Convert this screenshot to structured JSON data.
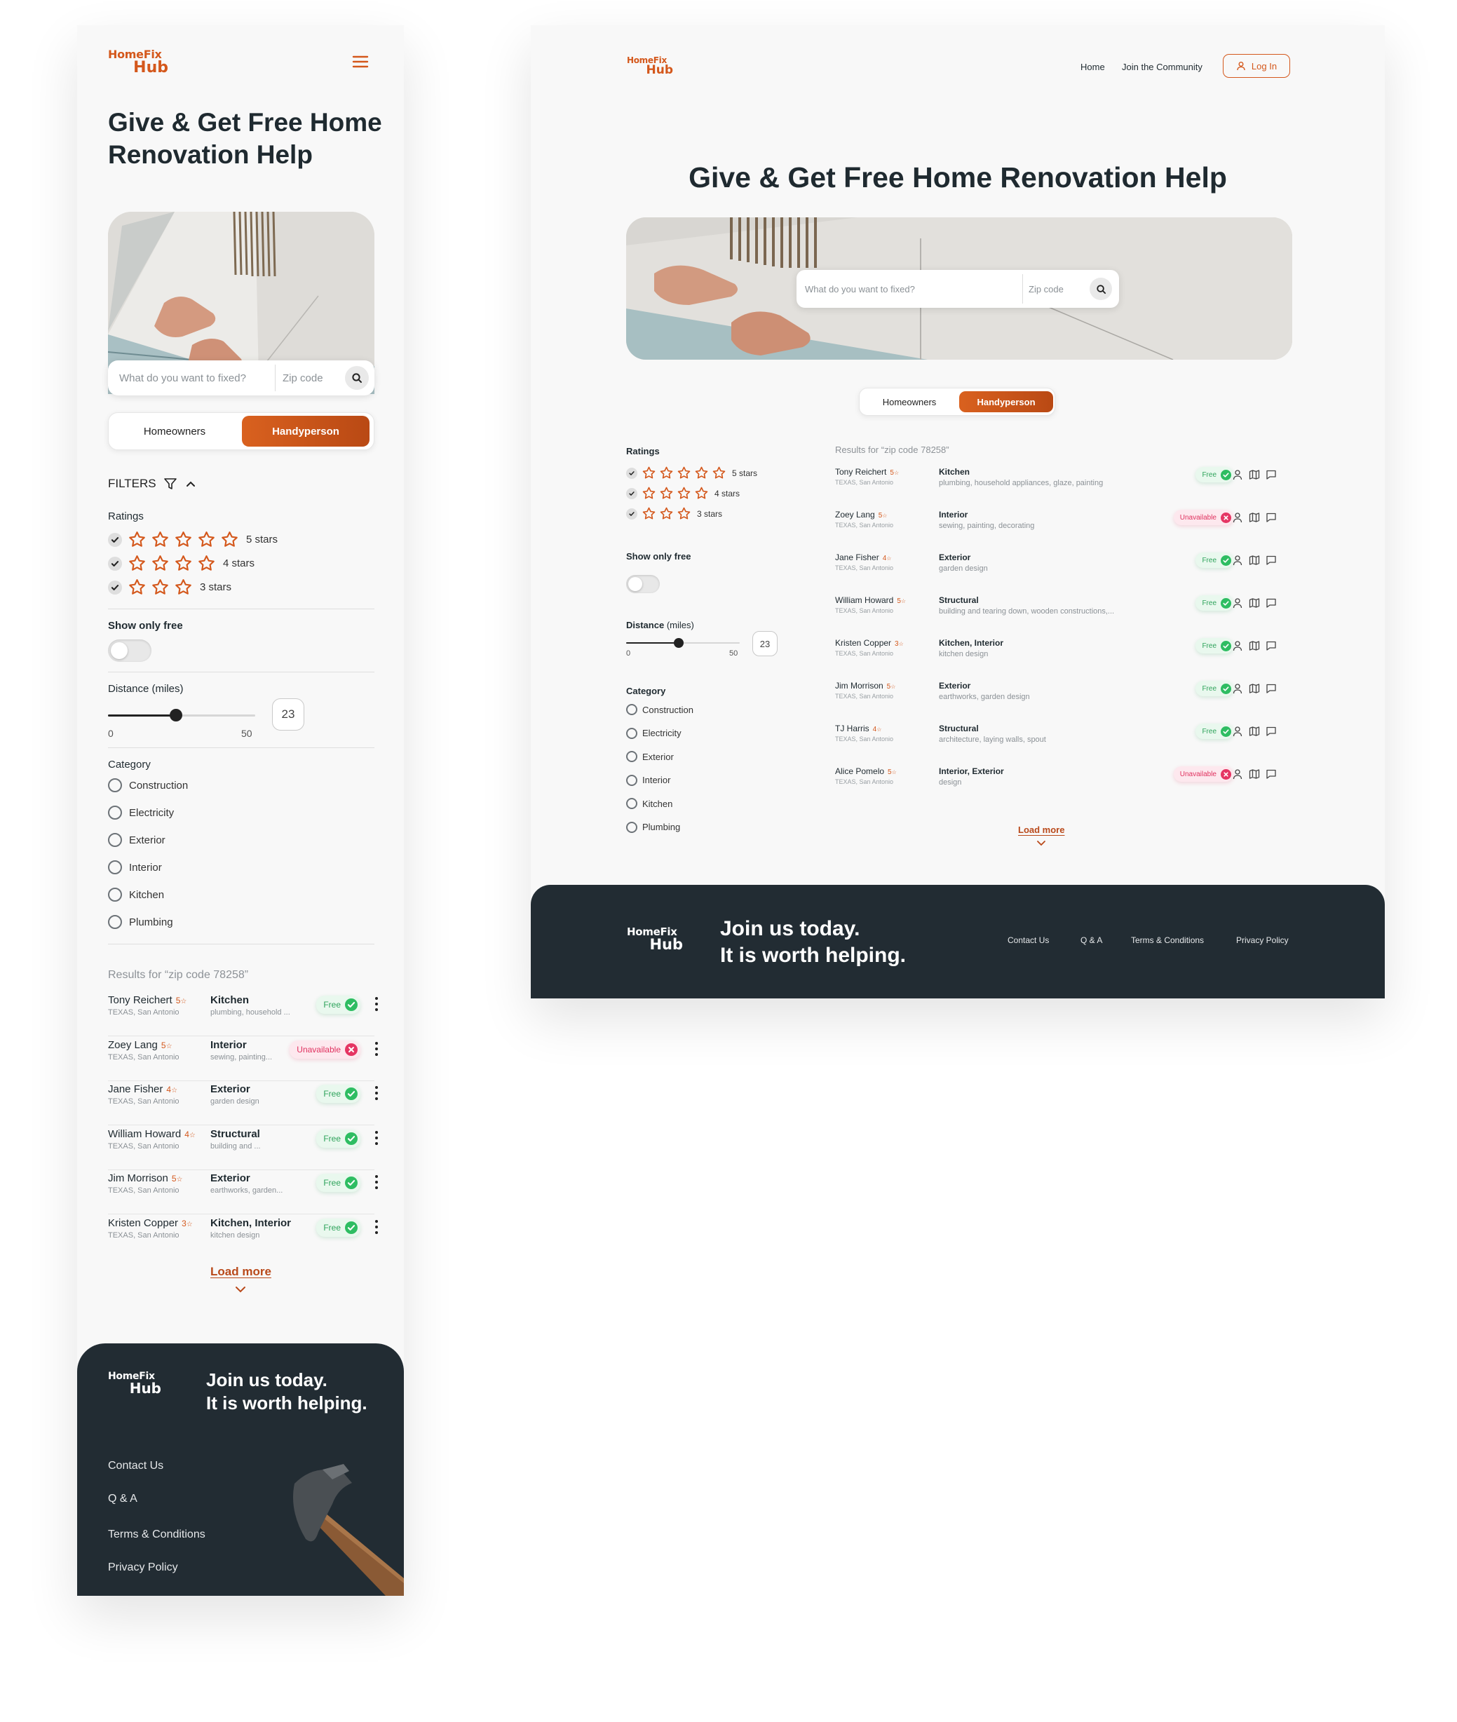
{
  "brand": {
    "line1": "HomeFix",
    "line2": "Hub"
  },
  "nav": {
    "home": "Home",
    "community": "Join the Community",
    "login": "Log In"
  },
  "hero": {
    "title": "Give & Get Free Home Renovation Help"
  },
  "search": {
    "placeholder": "What do you want to fixed?",
    "zip_placeholder": "Zip code"
  },
  "audience_toggle": {
    "options": [
      "Homeowners",
      "Handyperson"
    ],
    "selected": "Handyperson"
  },
  "filters": {
    "title": "FILTERS",
    "ratings_label": "Ratings",
    "ratings": [
      {
        "label": "5 stars",
        "stars": 5,
        "checked": true
      },
      {
        "label": "4 stars",
        "stars": 4,
        "checked": true
      },
      {
        "label": "3 stars",
        "stars": 3,
        "checked": true
      }
    ],
    "show_only_free_label": "Show only free",
    "show_only_free": false,
    "distance_label": "Distance",
    "distance_unit": "(miles)",
    "distance_min": "0",
    "distance_max": "50",
    "distance_value": "23",
    "category_label": "Category",
    "categories": [
      "Construction",
      "Electricity",
      "Exterior",
      "Interior",
      "Kitchen",
      "Plumbing"
    ]
  },
  "results": {
    "heading": "Results for “zip code 78258”",
    "location": "TEXAS, San Antonio",
    "desktop_rows": [
      {
        "name": "Tony Reichert",
        "rating": "5",
        "category": "Kitchen",
        "tags": "plumbing, household appliances, glaze, painting",
        "status": "Free"
      },
      {
        "name": "Zoey Lang",
        "rating": "5",
        "category": "Interior",
        "tags": "sewing, painting, decorating",
        "status": "Unavailable"
      },
      {
        "name": "Jane Fisher",
        "rating": "4",
        "category": "Exterior",
        "tags": "garden design",
        "status": "Free"
      },
      {
        "name": "William Howard",
        "rating": "5",
        "category": "Structural",
        "tags": "building and tearing down, wooden constructions,...",
        "status": "Free"
      },
      {
        "name": "Kristen Copper",
        "rating": "3",
        "category": "Kitchen, Interior",
        "tags": "kitchen design",
        "status": "Free"
      },
      {
        "name": "Jim Morrison",
        "rating": "5",
        "category": "Exterior",
        "tags": "earthworks, garden design",
        "status": "Free"
      },
      {
        "name": "TJ Harris",
        "rating": "4",
        "category": "Structural",
        "tags": "architecture, laying walls, spout",
        "status": "Free"
      },
      {
        "name": "Alice Pomelo",
        "rating": "5",
        "category": "Interior, Exterior",
        "tags": "design",
        "status": "Unavailable"
      }
    ],
    "mobile_rows": [
      {
        "name": "Tony Reichert",
        "rating": "5",
        "category": "Kitchen",
        "tags": "plumbing, household ...",
        "status": "Free"
      },
      {
        "name": "Zoey Lang",
        "rating": "5",
        "category": "Interior",
        "tags": "sewing, painting...",
        "status": "Unavailable"
      },
      {
        "name": "Jane Fisher",
        "rating": "4",
        "category": "Exterior",
        "tags": "garden design",
        "status": "Free"
      },
      {
        "name": "William Howard",
        "rating": "4",
        "category": "Structural",
        "tags": "building and ...",
        "status": "Free"
      },
      {
        "name": "Jim Morrison",
        "rating": "5",
        "category": "Exterior",
        "tags": "earthworks, garden...",
        "status": "Free"
      },
      {
        "name": "Kristen Copper",
        "rating": "3",
        "category": "Kitchen, Interior",
        "tags": "kitchen design",
        "status": "Free"
      }
    ],
    "load_more": "Load more"
  },
  "footer": {
    "slogan_line1": "Join us today.",
    "slogan_line2": "It is worth helping.",
    "links": [
      "Contact Us",
      "Q & A",
      "Terms & Conditions",
      "Privacy Policy"
    ]
  },
  "colors": {
    "accent": "#d4581c",
    "footer_bg": "#222c33",
    "free": "#2ebd62",
    "unavailable": "#e53563"
  },
  "icons": [
    "menu-icon",
    "search-icon",
    "user-icon",
    "filter-icon",
    "chevron-up-icon",
    "chevron-down-icon",
    "star-icon",
    "check-icon",
    "close-icon",
    "map-icon",
    "chat-icon",
    "more-vertical-icon",
    "hammer-icon"
  ]
}
